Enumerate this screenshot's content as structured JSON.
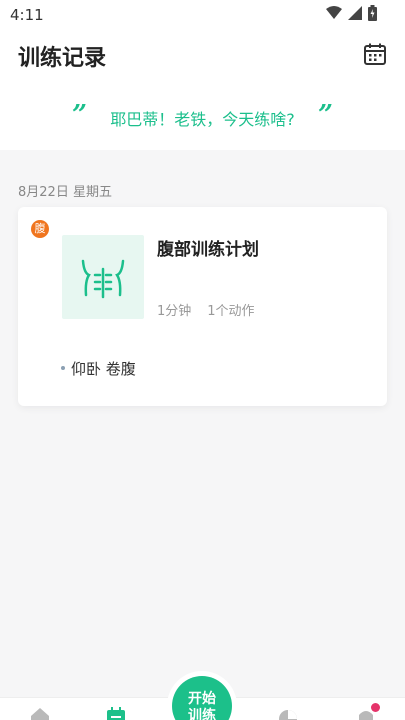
{
  "status_bar": {
    "time": "4:11"
  },
  "header": {
    "title": "训练记录",
    "quote": "耶巴蒂！老铁，今天练啥?",
    "quote_open": "”",
    "quote_close": "”"
  },
  "records": {
    "date_label": "8月22日 星期五",
    "card": {
      "badge": "腹",
      "plan_name": "腹部训练计划",
      "duration": "1分钟",
      "action_count": "1个动作",
      "exercise": "仰卧 卷腹"
    }
  },
  "bottom_nav": {
    "start_label_line1": "开始",
    "start_label_line2": "训练"
  },
  "colors": {
    "accent": "#1cc08a",
    "badge": "#f0751e",
    "notification": "#e5336a"
  }
}
